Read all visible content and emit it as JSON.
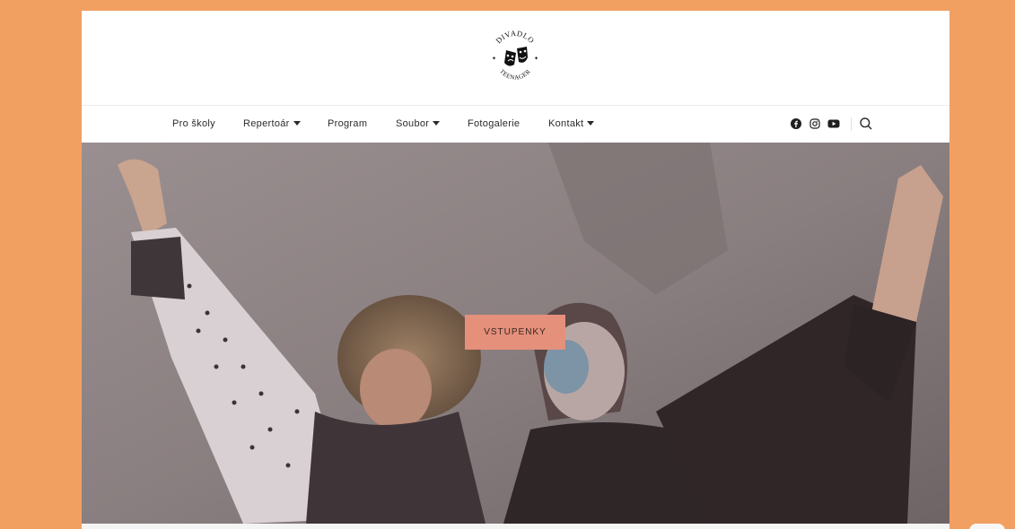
{
  "logo": {
    "top_text": "DIVADLO",
    "bottom_text": "TEENAGER"
  },
  "nav": {
    "items": [
      {
        "label": "Pro školy",
        "has_dropdown": false
      },
      {
        "label": "Repertoár",
        "has_dropdown": true
      },
      {
        "label": "Program",
        "has_dropdown": false
      },
      {
        "label": "Soubor",
        "has_dropdown": true
      },
      {
        "label": "Fotogalerie",
        "has_dropdown": false
      },
      {
        "label": "Kontakt",
        "has_dropdown": true
      }
    ],
    "social_icons": [
      "facebook-icon",
      "instagram-icon",
      "youtube-icon"
    ]
  },
  "hero": {
    "cta_label": "VSTUPENKY"
  },
  "colors": {
    "page_background": "#f2a062",
    "cta_background": "#e4907b",
    "nav_text": "#2b2b2b"
  }
}
